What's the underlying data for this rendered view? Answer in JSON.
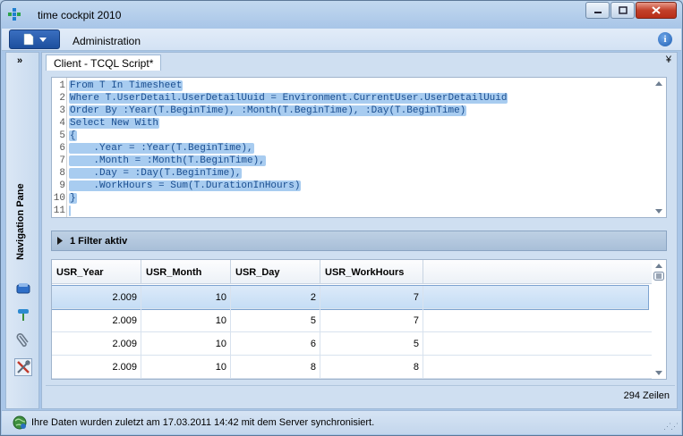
{
  "window": {
    "title": "time cockpit 2010"
  },
  "menu": {
    "administration": "Administration"
  },
  "nav": {
    "expand_label": "»",
    "pane_label": "Navigation Pane"
  },
  "tab": {
    "label": "Client - TCQL Script*",
    "close_glyph": "¥"
  },
  "editor": {
    "lines": [
      {
        "num": "1",
        "text": "From T In Timesheet"
      },
      {
        "num": "2",
        "text": "Where T.UserDetail.UserDetailUuid = Environment.CurrentUser.UserDetailUuid"
      },
      {
        "num": "3",
        "text": "Order By :Year(T.BeginTime), :Month(T.BeginTime), :Day(T.BeginTime)"
      },
      {
        "num": "4",
        "text": "Select New With"
      },
      {
        "num": "5",
        "text": "{"
      },
      {
        "num": "6",
        "text": "    .Year = :Year(T.BeginTime),"
      },
      {
        "num": "7",
        "text": "    .Month = :Month(T.BeginTime),"
      },
      {
        "num": "8",
        "text": "    .Day = :Day(T.BeginTime),"
      },
      {
        "num": "9",
        "text": "    .WorkHours = Sum(T.DurationInHours)"
      },
      {
        "num": "10",
        "text": "}"
      },
      {
        "num": "11",
        "text": ""
      }
    ]
  },
  "filter": {
    "label": "1 Filter aktiv"
  },
  "grid": {
    "columns": [
      "USR_Year",
      "USR_Month",
      "USR_Day",
      "USR_WorkHours"
    ],
    "rows": [
      [
        "2.009",
        "10",
        "2",
        "7"
      ],
      [
        "2.009",
        "10",
        "5",
        "7"
      ],
      [
        "2.009",
        "10",
        "6",
        "5"
      ],
      [
        "2.009",
        "10",
        "8",
        "8"
      ]
    ],
    "selected_row": 0,
    "row_count": "294 Zeilen"
  },
  "status": {
    "text": "Ihre Daten wurden zuletzt am 17.03.2011 14:42 mit dem Server synchronisiert."
  },
  "colors": {
    "selection": "#a8ccf0",
    "app_menu_button": "#1d4f9e",
    "close_button": "#c2402a"
  }
}
